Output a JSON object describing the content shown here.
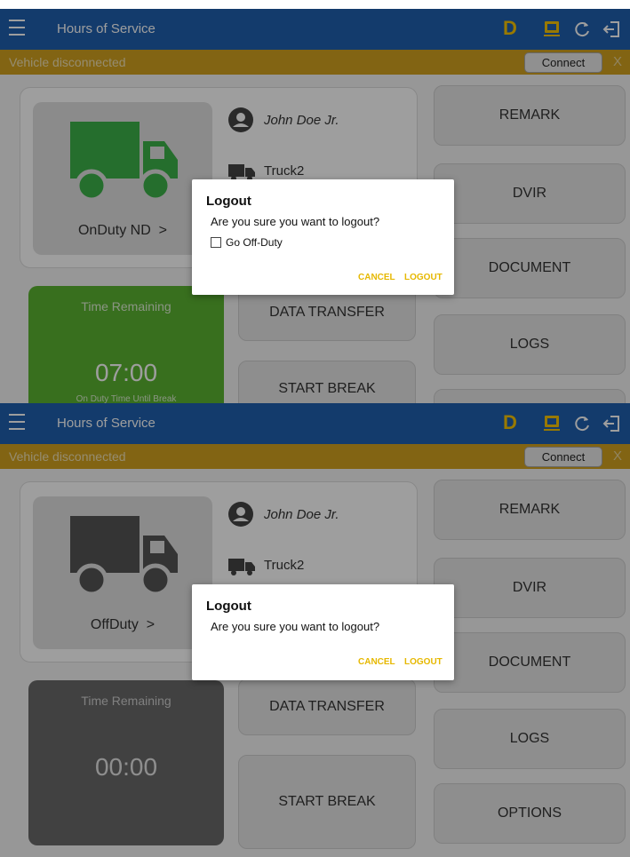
{
  "app": {
    "title": "Hours of Service",
    "mode_letter": "D"
  },
  "icons": {
    "menu": "menu-icon",
    "device": "device-icon",
    "refresh": "refresh-icon",
    "logout": "logout-icon"
  },
  "colors": {
    "topbar": "#1f5fae",
    "banner": "#d2a220",
    "accent": "#e6b800",
    "on_duty_green": "#5bb431"
  },
  "banner": {
    "text": "Vehicle disconnected",
    "connect_label": "Connect",
    "close_label": "X"
  },
  "screens": [
    {
      "status": "OnDuty ND",
      "chevron": ">",
      "driver": "John Doe Jr.",
      "truck": "Truck2",
      "time_remaining": {
        "label": "Time Remaining",
        "value": "07:00",
        "sub": "On Duty Time Until Break"
      },
      "center_buttons": [
        "DATA TRANSFER",
        "START BREAK"
      ],
      "right_buttons": [
        "REMARK",
        "DVIR",
        "DOCUMENT",
        "LOGS"
      ],
      "dialog": {
        "title": "Logout",
        "message": "Are you sure you want to logout?",
        "checkbox_label": "Go Off-Duty",
        "checkbox_checked": false,
        "cancel": "CANCEL",
        "confirm": "LOGOUT"
      }
    },
    {
      "status": "OffDuty",
      "chevron": ">",
      "driver": "John Doe Jr.",
      "truck": "Truck2",
      "time_remaining": {
        "label": "Time Remaining",
        "value": "00:00"
      },
      "center_buttons": [
        "DATA TRANSFER",
        "START BREAK"
      ],
      "right_buttons": [
        "REMARK",
        "DVIR",
        "DOCUMENT",
        "LOGS",
        "OPTIONS"
      ],
      "dialog": {
        "title": "Logout",
        "message": "Are you sure you want to logout?",
        "cancel": "CANCEL",
        "confirm": "LOGOUT"
      }
    }
  ]
}
